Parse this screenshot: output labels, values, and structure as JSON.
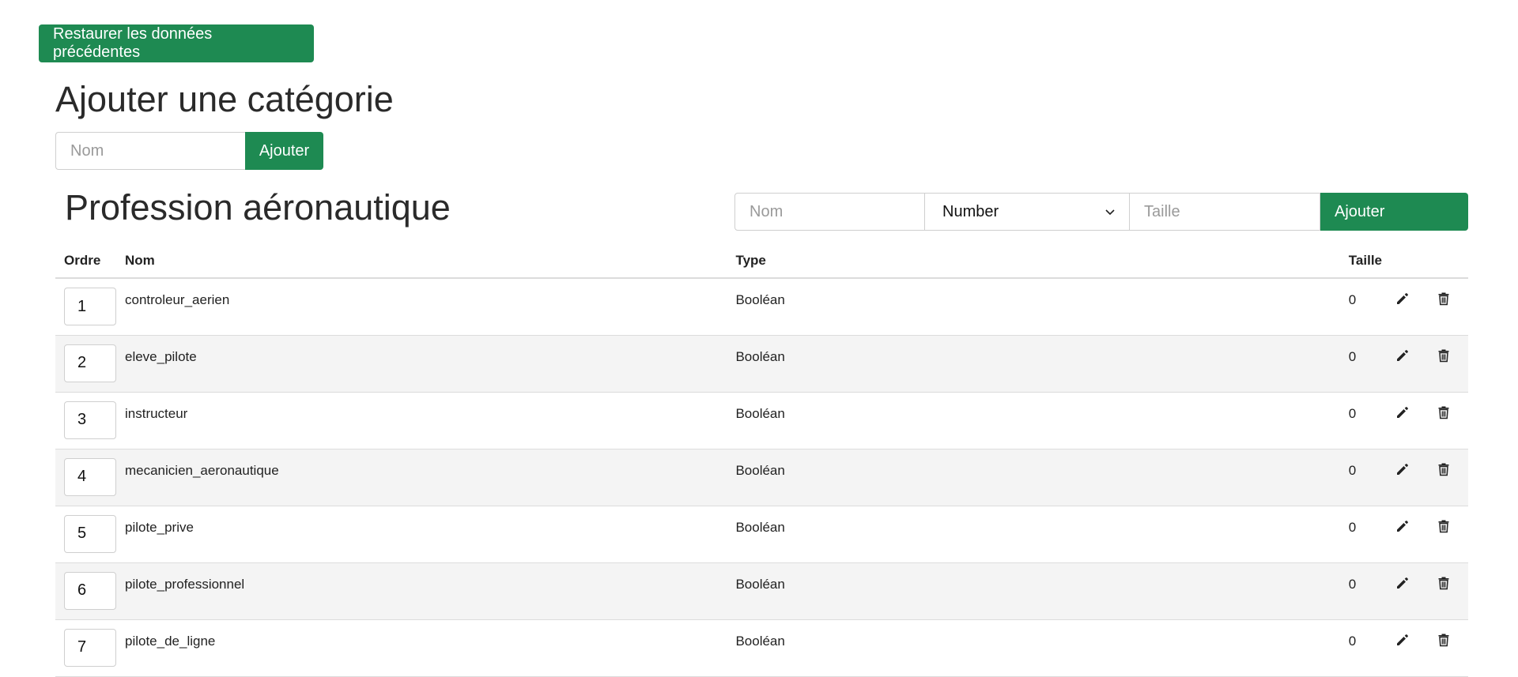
{
  "restore_button": {
    "label": "Restaurer les données précédentes"
  },
  "add_category": {
    "title": "Ajouter une catégorie",
    "name_placeholder": "Nom",
    "add_label": "Ajouter"
  },
  "section": {
    "title": "Profession aéronautique",
    "field_form": {
      "name_placeholder": "Nom",
      "type_selected": "Number",
      "size_placeholder": "Taille",
      "add_label": "Ajouter"
    }
  },
  "table": {
    "headers": {
      "order": "Ordre",
      "name": "Nom",
      "type": "Type",
      "size": "Taille"
    },
    "rows": [
      {
        "order": "1",
        "name": "controleur_aerien",
        "type": "Booléan",
        "size": "0"
      },
      {
        "order": "2",
        "name": "eleve_pilote",
        "type": "Booléan",
        "size": "0"
      },
      {
        "order": "3",
        "name": "instructeur",
        "type": "Booléan",
        "size": "0"
      },
      {
        "order": "4",
        "name": "mecanicien_aeronautique",
        "type": "Booléan",
        "size": "0"
      },
      {
        "order": "5",
        "name": "pilote_prive",
        "type": "Booléan",
        "size": "0"
      },
      {
        "order": "6",
        "name": "pilote_professionnel",
        "type": "Booléan",
        "size": "0"
      },
      {
        "order": "7",
        "name": "pilote_de_ligne",
        "type": "Booléan",
        "size": "0"
      }
    ],
    "row_icons": [
      "pencil-icon",
      "trash-icon"
    ]
  },
  "colors": {
    "accent": "#1e8a52",
    "row_alt": "#f4f4f4",
    "border": "#dcdcdc"
  }
}
